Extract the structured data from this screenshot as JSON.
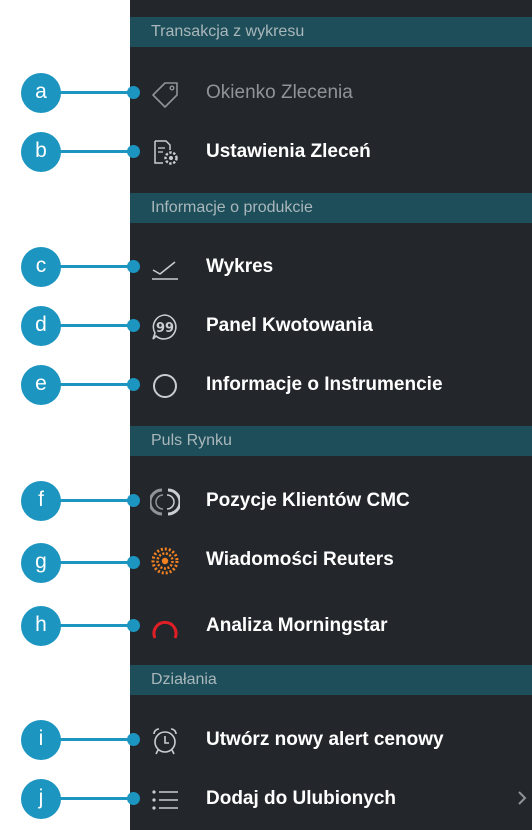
{
  "colors": {
    "menu_bg": "#23272b",
    "section_bg": "#1d4e5a",
    "callout": "#1c95c0",
    "morningstar_red": "#e01e26",
    "reuters_orange": "#f58220"
  },
  "sections": {
    "trade": "Transakcja z wykresu",
    "product": "Informacje o produkcie",
    "market": "Puls Rynku",
    "actions": "Działania"
  },
  "items": {
    "order_ticket": {
      "label": "Okienko Zlecenia",
      "icon": "price-tag-icon",
      "enabled": false
    },
    "order_settings": {
      "label": "Ustawienia Zleceń",
      "icon": "settings-doc-icon"
    },
    "chart": {
      "label": "Wykres",
      "icon": "chart-line-icon"
    },
    "price_panel": {
      "label": "Panel Kwotowania",
      "icon": "quote-bubble-icon"
    },
    "instrument_info": {
      "label": "Informacje o Instrumencie",
      "icon": "circle-info-icon"
    },
    "client_positions": {
      "label": "Pozycje Klientów CMC",
      "icon": "client-sentiment-icon"
    },
    "reuters_news": {
      "label": "Wiadomości Reuters",
      "icon": "reuters-logo-icon"
    },
    "morningstar": {
      "label": "Analiza Morningstar",
      "icon": "morningstar-logo-icon"
    },
    "price_alert": {
      "label": "Utwórz nowy alert cenowy",
      "icon": "alarm-clock-icon"
    },
    "favourites": {
      "label": "Dodaj do Ulubionych",
      "icon": "list-icon",
      "has_submenu": true
    }
  },
  "callouts": {
    "a": "a",
    "b": "b",
    "c": "c",
    "d": "d",
    "e": "e",
    "f": "f",
    "g": "g",
    "h": "h",
    "i": "i",
    "j": "j"
  }
}
